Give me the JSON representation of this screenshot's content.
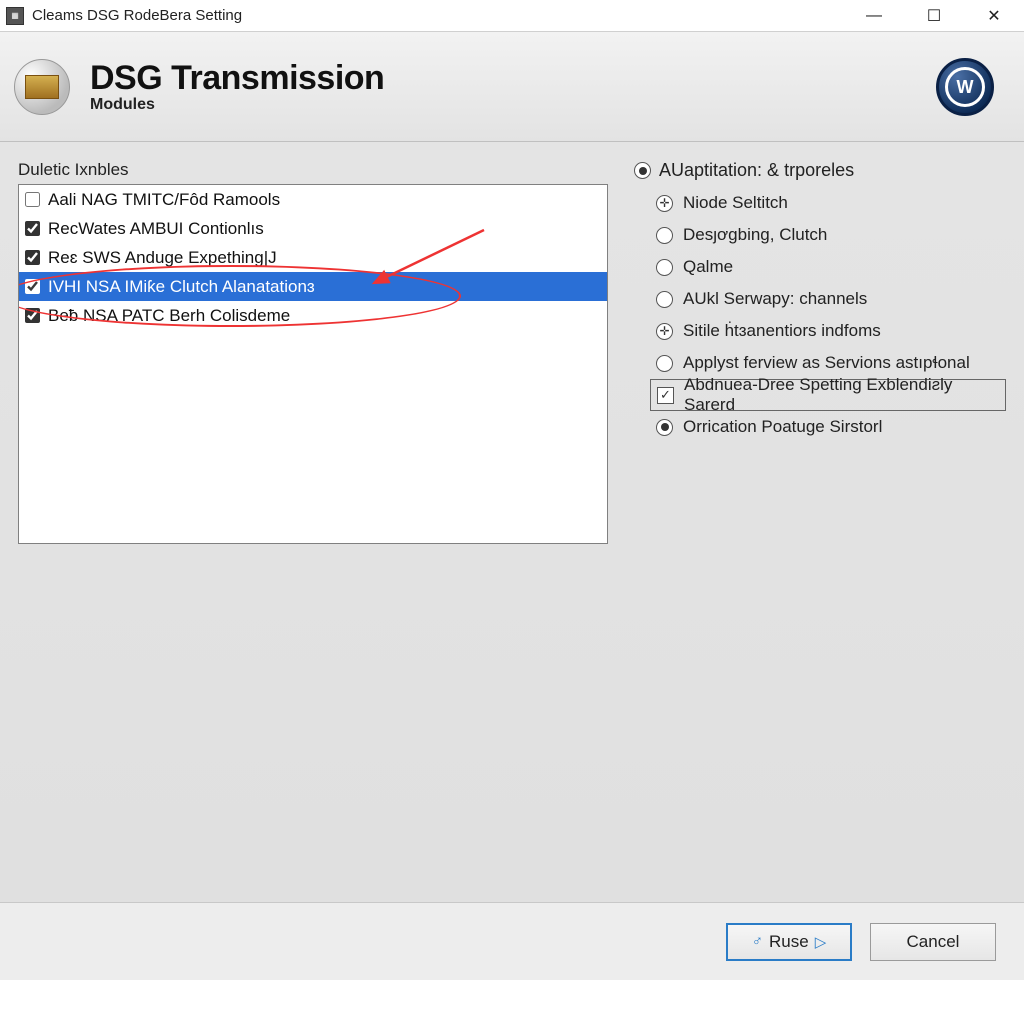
{
  "window": {
    "title": "Cleams DSG RodeBera Setting"
  },
  "header": {
    "title": "DSG Transmission",
    "subtitle": "Modules",
    "logo_letter": "W"
  },
  "left_panel": {
    "group_label": "Duletic Ixnbles",
    "items": [
      {
        "label": "Aali NAG TMITC/Fôd Ramools",
        "checked": false,
        "selected": false
      },
      {
        "label": "RecWates AMBUI Contionlıs",
        "checked": true,
        "selected": false
      },
      {
        "label": "Reɛ SWS Anduge Expething|J",
        "checked": true,
        "selected": false
      },
      {
        "label": "IVHI NSA IMiƙe Clutch Alanatationɜ",
        "checked": true,
        "selected": true
      },
      {
        "label": "Beƀ NSA PATC Berh Colisdeme",
        "checked": true,
        "selected": false
      }
    ]
  },
  "right_panel": {
    "heading": "AUaptitation: & trporeles",
    "options": [
      {
        "kind": "plus",
        "label": "Niode Seltitch"
      },
      {
        "kind": "radio",
        "label": "Desȷơgbing, Clutch"
      },
      {
        "kind": "radio",
        "label": "Qalme"
      },
      {
        "kind": "radio",
        "label": "AUkl Serwapy: channels"
      },
      {
        "kind": "plus",
        "label": "Sitile ḣtɜanentiors indfoms"
      },
      {
        "kind": "radio",
        "label": "Applyst ferview as Servions astıpɬonal"
      },
      {
        "kind": "checkbox_boxed",
        "label": "Abdnuea-Dree Spetting Exblendiƨly Sarerd",
        "checked": true
      },
      {
        "kind": "radio_filled",
        "label": "Orrication Poatuge Sirstorl"
      }
    ]
  },
  "footer": {
    "ok_label": "Ruse",
    "cancel_label": "Cancel"
  }
}
